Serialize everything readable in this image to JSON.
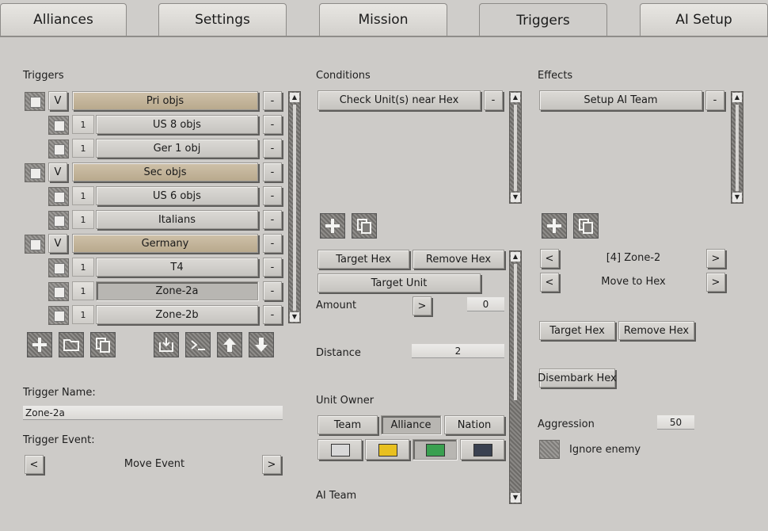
{
  "tabs": [
    "Alliances",
    "Settings",
    "Mission",
    "Triggers",
    "AI Setup"
  ],
  "triggers": {
    "heading": "Triggers",
    "rows": [
      {
        "toggle": "V",
        "label": "Pri objs",
        "remove": "-"
      },
      {
        "num": "1",
        "label": "US 8 objs",
        "remove": "-"
      },
      {
        "num": "1",
        "label": "Ger 1 obj",
        "remove": "-"
      },
      {
        "toggle": "V",
        "label": "Sec objs",
        "remove": "-"
      },
      {
        "num": "1",
        "label": "US 6 objs",
        "remove": "-"
      },
      {
        "num": "1",
        "label": "Italians",
        "remove": "-"
      },
      {
        "toggle": "V",
        "label": "Germany",
        "remove": "-"
      },
      {
        "num": "1",
        "label": "T4",
        "remove": "-"
      },
      {
        "num": "1",
        "label": "Zone-2a",
        "remove": "-"
      },
      {
        "num": "1",
        "label": "Zone-2b",
        "remove": "-"
      }
    ],
    "name_label": "Trigger Name:",
    "name_value": "Zone-2a",
    "event_label": "Trigger Event:",
    "event_value": "Move Event",
    "prev": "<",
    "next": ">"
  },
  "conditions": {
    "heading": "Conditions",
    "item": "Check Unit(s) near Hex",
    "remove": "-",
    "target_hex": "Target Hex",
    "remove_hex": "Remove Hex",
    "target_unit": "Target Unit",
    "amount_label": "Amount",
    "amount_btn": ">",
    "amount_value": "0",
    "distance_label": "Distance",
    "distance_value": "2",
    "owner_label": "Unit Owner",
    "owner_tabs": [
      "Team",
      "Alliance",
      "Nation"
    ],
    "owner_colors": [
      "#d8d8d8",
      "#e8c020",
      "#3aa050",
      "#3a4150"
    ],
    "ai_team_label": "AI Team"
  },
  "effects": {
    "heading": "Effects",
    "item": "Setup AI Team",
    "remove": "-",
    "zone_value": "[4] Zone-2",
    "action_value": "Move to Hex",
    "prev": "<",
    "next": ">",
    "target_hex": "Target Hex",
    "remove_hex": "Remove Hex",
    "disembark_hex": "Disembark Hex",
    "aggression_label": "Aggression",
    "aggression_value": "50",
    "ignore_enemy_label": "Ignore enemy"
  }
}
